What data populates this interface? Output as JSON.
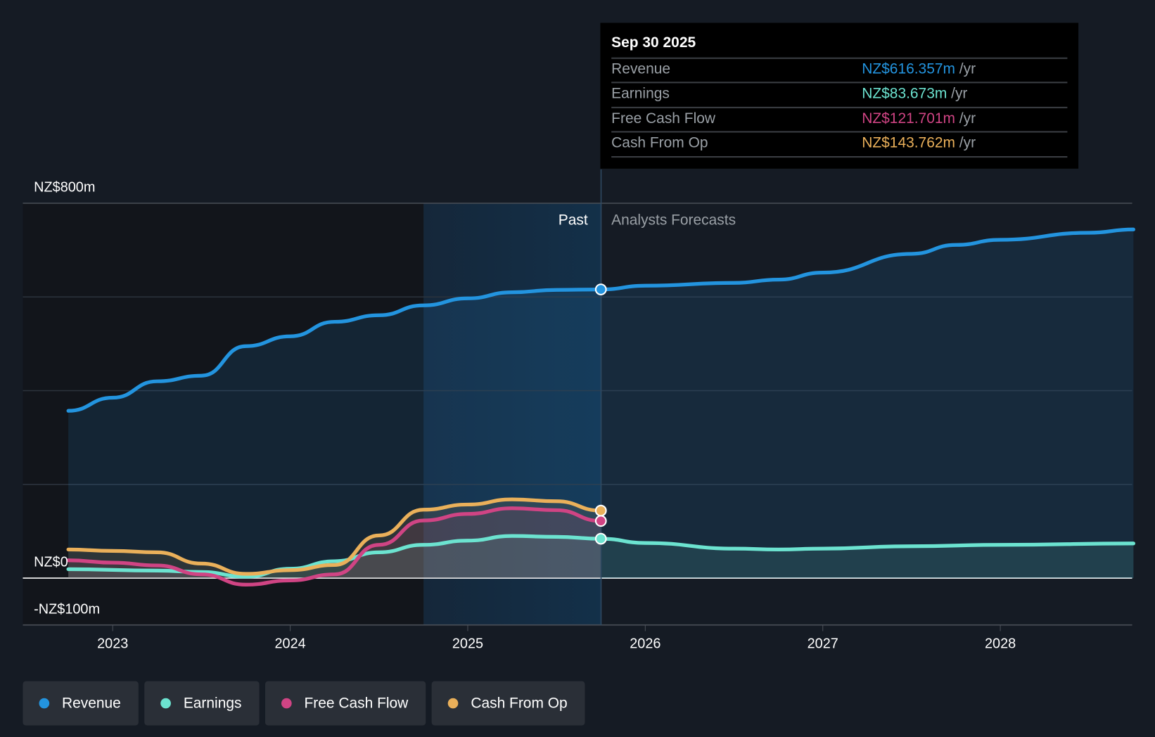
{
  "tooltip": {
    "date": "Sep 30 2025",
    "rows": [
      {
        "label": "Revenue",
        "value": "NZ$616.357m",
        "unit": "/yr",
        "color": "#2394df"
      },
      {
        "label": "Earnings",
        "value": "NZ$83.673m",
        "unit": "/yr",
        "color": "#6ce3d0"
      },
      {
        "label": "Free Cash Flow",
        "value": "NZ$121.701m",
        "unit": "/yr",
        "color": "#d04484"
      },
      {
        "label": "Cash From Op",
        "value": "NZ$143.762m",
        "unit": "/yr",
        "color": "#eab05a"
      }
    ]
  },
  "legend": [
    {
      "label": "Revenue",
      "color": "#2394df"
    },
    {
      "label": "Earnings",
      "color": "#6ce3d0"
    },
    {
      "label": "Free Cash Flow",
      "color": "#d04484"
    },
    {
      "label": "Cash From Op",
      "color": "#eab05a"
    }
  ],
  "chart_data": {
    "type": "line",
    "ylim": [
      -100,
      800
    ],
    "y_tick_labels": [
      "NZ$800m",
      "NZ$0",
      "-NZ$100m"
    ],
    "x_tick_labels": [
      "2023",
      "2024",
      "2025",
      "2026",
      "2027",
      "2028"
    ],
    "xlim": [
      2022.5,
      2028.75
    ],
    "past_label": "Past",
    "forecast_label": "Analysts Forecasts",
    "divider_x": 2025.75,
    "grid": true,
    "series": [
      {
        "name": "Revenue",
        "color": "#2394df",
        "x": [
          2022.75,
          2023.0,
          2023.25,
          2023.5,
          2023.75,
          2024.0,
          2024.25,
          2024.5,
          2024.75,
          2025.0,
          2025.25,
          2025.5,
          2025.75,
          2026.0,
          2026.5,
          2026.75,
          2027.0,
          2027.5,
          2027.75,
          2028.0,
          2028.5,
          2028.75
        ],
        "y": [
          357,
          385,
          420,
          432,
          495,
          516,
          547,
          561,
          582,
          597,
          610,
          615,
          616,
          624,
          630,
          637,
          652,
          692,
          711,
          722,
          737,
          744
        ]
      },
      {
        "name": "Earnings",
        "color": "#6ce3d0",
        "x": [
          2022.75,
          2023.25,
          2023.5,
          2023.75,
          2024.0,
          2024.25,
          2024.5,
          2024.75,
          2025.0,
          2025.25,
          2025.5,
          2025.75,
          2026.0,
          2026.5,
          2026.75,
          2027.0,
          2027.5,
          2028.0,
          2028.75
        ],
        "y": [
          19,
          16,
          13,
          3,
          20,
          36,
          55,
          71,
          80,
          90,
          88,
          84,
          75,
          63,
          61,
          63,
          68,
          71,
          74
        ]
      },
      {
        "name": "Free Cash Flow",
        "color": "#d04484",
        "x": [
          2022.75,
          2023.0,
          2023.25,
          2023.5,
          2023.75,
          2024.0,
          2024.25,
          2024.5,
          2024.75,
          2025.0,
          2025.25,
          2025.5,
          2025.75
        ],
        "y": [
          38,
          33,
          27,
          8,
          -14,
          -5,
          8,
          71,
          123,
          137,
          149,
          145,
          122
        ]
      },
      {
        "name": "Cash From Op",
        "color": "#eab05a",
        "x": [
          2022.75,
          2023.0,
          2023.25,
          2023.5,
          2023.75,
          2024.0,
          2024.25,
          2024.5,
          2024.75,
          2025.0,
          2025.25,
          2025.5,
          2025.75
        ],
        "y": [
          61,
          58,
          55,
          31,
          9,
          17,
          28,
          91,
          146,
          157,
          168,
          164,
          144
        ]
      }
    ]
  }
}
